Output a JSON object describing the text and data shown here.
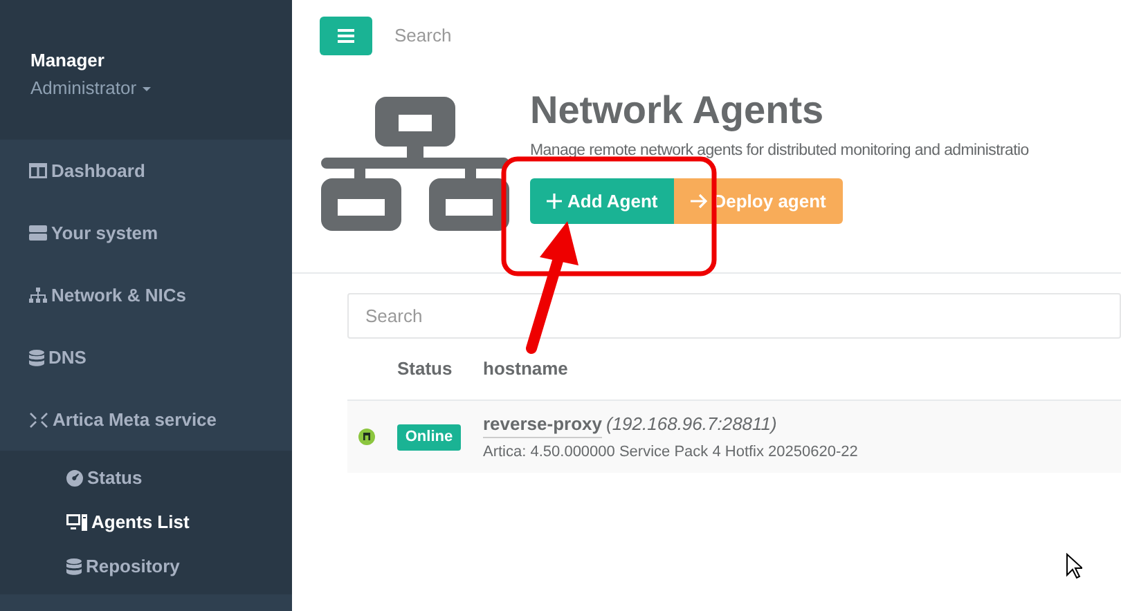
{
  "sidebar": {
    "user": {
      "name": "Manager",
      "role": "Administrator"
    },
    "items": [
      {
        "label": "Dashboard"
      },
      {
        "label": "Your system"
      },
      {
        "label": "Network & NICs"
      },
      {
        "label": "DNS"
      },
      {
        "label": "Artica Meta service",
        "children": [
          {
            "label": "Status",
            "selected": false
          },
          {
            "label": "Agents List",
            "selected": true
          },
          {
            "label": "Repository",
            "selected": false
          }
        ]
      }
    ]
  },
  "topbar": {
    "search": {
      "placeholder": "Search"
    }
  },
  "header": {
    "title": "Network Agents",
    "subtitle": "Manage remote network agents for distributed monitoring and administratio",
    "buttons": [
      {
        "label": "Add Agent",
        "kind": "add"
      },
      {
        "label": "Deploy agent",
        "kind": "deploy"
      }
    ]
  },
  "table": {
    "search": {
      "placeholder": "Search"
    },
    "columns": [
      "Status",
      "hostname"
    ],
    "rows": [
      {
        "status": "Online",
        "hostname": "reverse-proxy",
        "address": "(192.168.96.7:28811)",
        "version": "Artica: 4.50.000000 Service Pack 4 Hotfix 20250620-22"
      }
    ]
  }
}
